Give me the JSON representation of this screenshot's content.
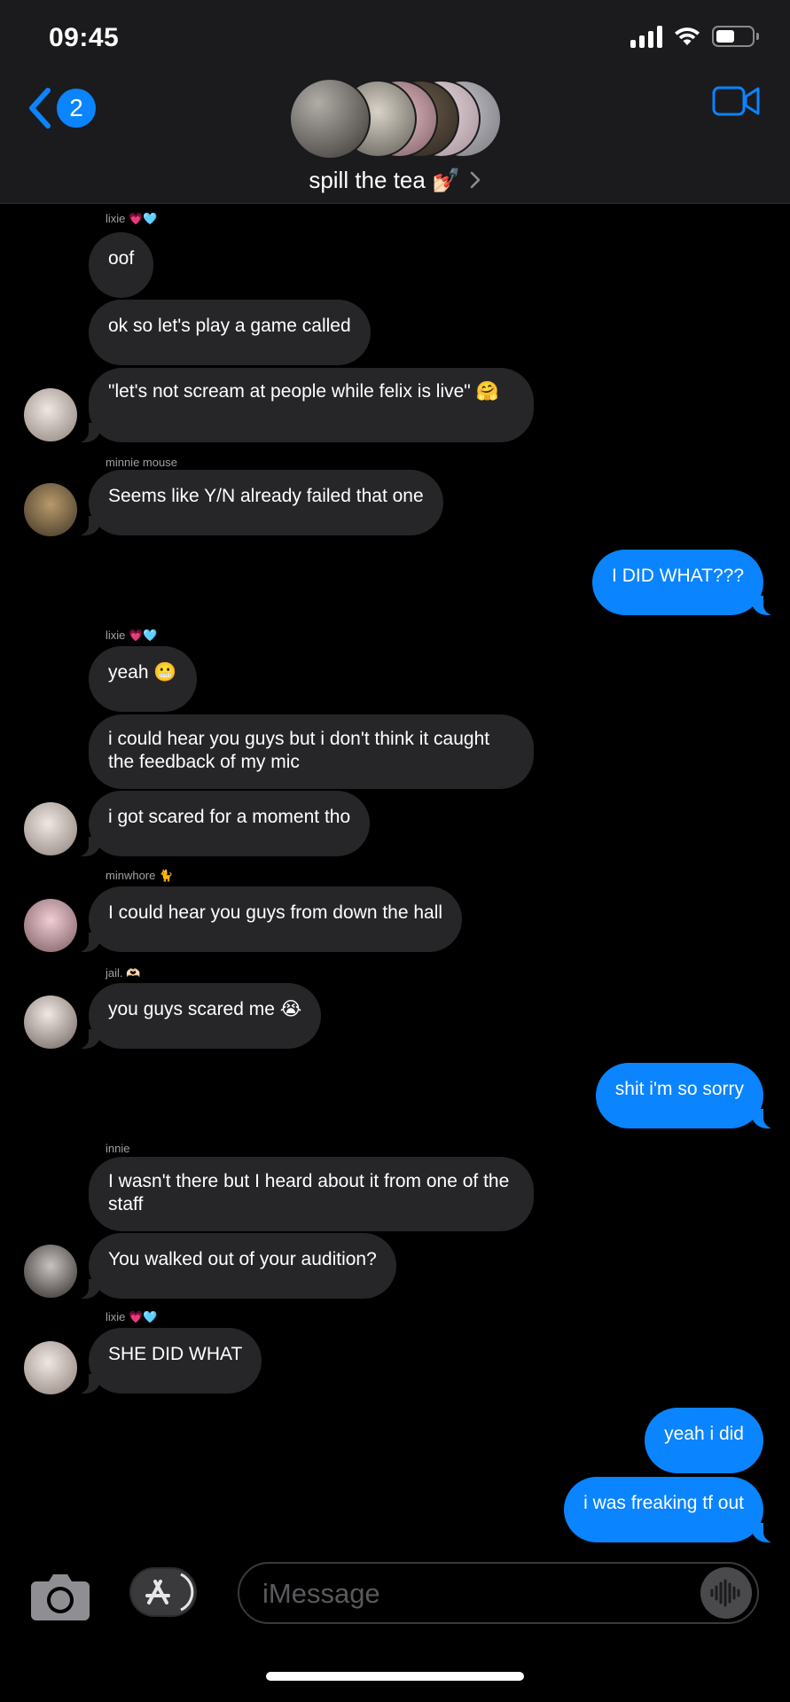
{
  "status_bar": {
    "time": "09:45"
  },
  "header": {
    "back_count": "2",
    "group_name": "spill the tea 💅🏻"
  },
  "messages": [
    {
      "sender": "lixie 💗🩵",
      "text": "oof"
    },
    {
      "text": "ok so let's play a game called"
    },
    {
      "text": "\"let's not scream at people while felix is live\" 🤗"
    },
    {
      "sender": "minnie mouse",
      "text": "Seems like Y/N already failed that one"
    },
    {
      "text": "I DID WHAT???"
    },
    {
      "sender": "lixie 💗🩵",
      "text": "yeah 😬"
    },
    {
      "text": "i could hear you guys but i don't think it caught the feedback of my mic"
    },
    {
      "text": "i got scared for a moment tho"
    },
    {
      "sender": "minwhore 🐈",
      "text": "I could hear you guys from down the hall"
    },
    {
      "sender": "jail. 🫶🏻",
      "text": "you guys scared me 😭"
    },
    {
      "text": "shit i'm so sorry"
    },
    {
      "sender": "innie",
      "text": "I wasn't there but I heard about it from one of the staff"
    },
    {
      "text": "You walked out of your audition?"
    },
    {
      "sender": "lixie 💗🩵",
      "text": "SHE DID WHAT"
    },
    {
      "text": "yeah i did"
    },
    {
      "text": "i was freaking tf out"
    }
  ],
  "composer": {
    "placeholder": "iMessage"
  },
  "colors": {
    "accent": "#0a84ff",
    "incoming": "#262628",
    "background": "#000000",
    "header": "#1b1b1d"
  },
  "icons": [
    "back-chevron-icon",
    "video-camera-icon",
    "camera-icon",
    "app-store-icon",
    "audio-waveform-icon",
    "signal-icon",
    "wifi-icon",
    "battery-icon"
  ]
}
